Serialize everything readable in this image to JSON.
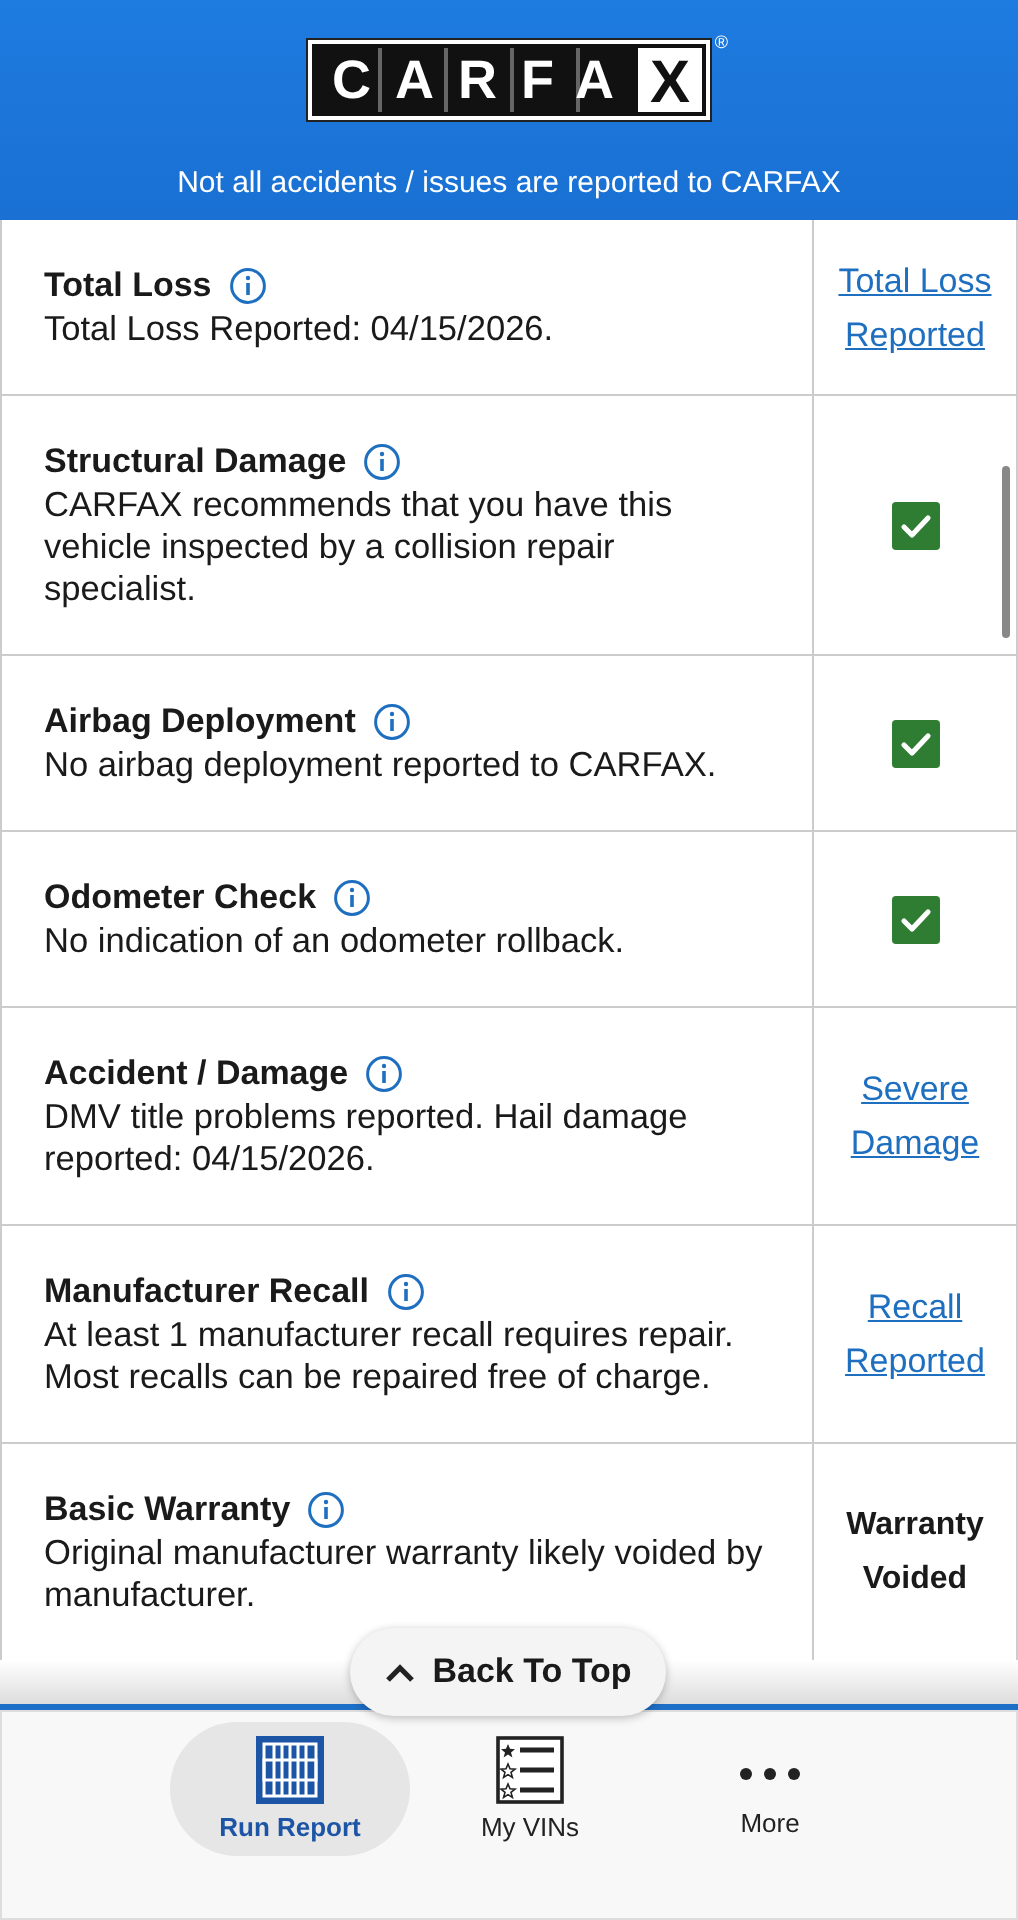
{
  "header": {
    "logo": "CARFAX",
    "logo_mark": "®",
    "notice": "Not all accidents / issues are reported to CARFAX"
  },
  "rows": [
    {
      "title": "Total Loss",
      "description": "Total Loss Reported: 04/15/2026.",
      "result": {
        "kind": "link",
        "text": "Total Loss Reported"
      }
    },
    {
      "title": "Structural Damage",
      "description": "CARFAX recommends that you have this vehicle inspected by a collision repair specialist.",
      "result": {
        "kind": "check",
        "checked": true
      }
    },
    {
      "title": "Airbag Deployment",
      "description": "No airbag deployment reported to CARFAX.",
      "result": {
        "kind": "check",
        "checked": true
      }
    },
    {
      "title": "Odometer Check",
      "description": "No indication of an odometer rollback.",
      "result": {
        "kind": "check",
        "checked": true
      }
    },
    {
      "title": "Accident / Damage",
      "description": "DMV title problems reported. Hail damage reported: 04/15/2026.",
      "result": {
        "kind": "link",
        "text": "Severe Damage"
      }
    },
    {
      "title": "Manufacturer Recall",
      "description": "At least 1 manufacturer recall requires repair. Most recalls can be repaired free of charge.",
      "result": {
        "kind": "link",
        "text": "Recall Reported"
      }
    },
    {
      "title": "Basic Warranty",
      "description": "Original manufacturer warranty likely voided by manufacturer.",
      "result": {
        "kind": "text",
        "text": "Warranty Voided"
      }
    }
  ],
  "back_to_top": "Back To Top",
  "nav": [
    {
      "label": "Run Report",
      "kind": "scan",
      "selected": true
    },
    {
      "label": "My VINs",
      "kind": "vins",
      "selected": false
    },
    {
      "label": "More",
      "kind": "more",
      "selected": false
    }
  ]
}
